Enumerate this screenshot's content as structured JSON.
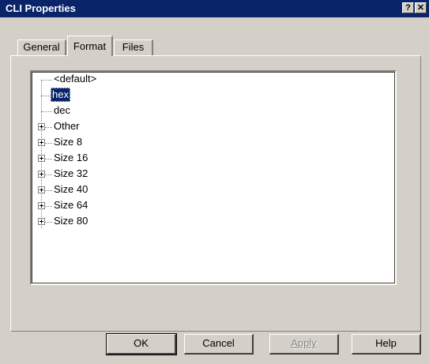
{
  "window": {
    "title": "CLI Properties",
    "help_glyph": "?",
    "close_glyph": "✕"
  },
  "tabs": [
    {
      "label": "General",
      "active": false
    },
    {
      "label": "Format",
      "active": true
    },
    {
      "label": "Files",
      "active": false
    }
  ],
  "tree": {
    "items": [
      {
        "label": "<default>",
        "expandable": false,
        "selected": false
      },
      {
        "label": "hex",
        "expandable": false,
        "selected": true
      },
      {
        "label": "dec",
        "expandable": false,
        "selected": false
      },
      {
        "label": "Other",
        "expandable": true,
        "selected": false
      },
      {
        "label": "Size 8",
        "expandable": true,
        "selected": false
      },
      {
        "label": "Size 16",
        "expandable": true,
        "selected": false
      },
      {
        "label": "Size 32",
        "expandable": true,
        "selected": false
      },
      {
        "label": "Size 40",
        "expandable": true,
        "selected": false
      },
      {
        "label": "Size 64",
        "expandable": true,
        "selected": false
      },
      {
        "label": "Size 80",
        "expandable": true,
        "selected": false
      }
    ]
  },
  "buttons": {
    "ok": "OK",
    "cancel": "Cancel",
    "apply": "Apply",
    "help": "Help"
  }
}
